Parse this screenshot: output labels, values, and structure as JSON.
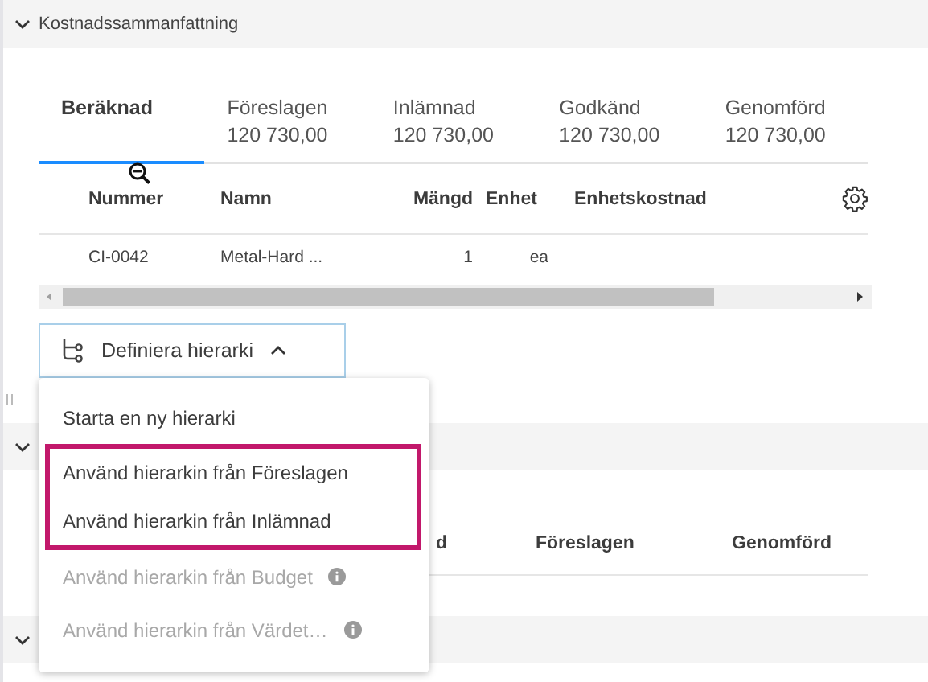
{
  "summary": {
    "title": "Kostnadssammanfattning",
    "expanded": true,
    "tabs": [
      {
        "label": "Beräknad",
        "selected": true
      },
      {
        "label": "Föreslagen",
        "value": "120 730,00",
        "selected": false
      },
      {
        "label": "Inlämnad",
        "value": "120 730,00",
        "selected": false
      },
      {
        "label": "Godkänd",
        "value": "120 730,00",
        "selected": false
      },
      {
        "label": "Genomförd",
        "value": "120 730,00",
        "selected": false
      }
    ],
    "table": {
      "columns": [
        "Nummer",
        "Namn",
        "Mängd",
        "Enhet",
        "Enhetskostnad"
      ],
      "rows": [
        [
          "CI-0042",
          "Metal-Hard ...",
          "1",
          "ea",
          ""
        ]
      ]
    },
    "hierarchy_button": {
      "label": "Definiera hierarki",
      "open": true
    }
  },
  "menu": {
    "items": [
      {
        "label": "Starta en ny hierarki",
        "disabled": false,
        "highlighted": false,
        "info": false
      },
      {
        "label": "Använd hierarkin från Föreslagen",
        "disabled": false,
        "highlighted": true,
        "info": false
      },
      {
        "label": "Använd hierarkin från Inlämnad",
        "disabled": false,
        "highlighted": true,
        "info": false
      },
      {
        "label": "Använd hierarkin från Budget",
        "disabled": true,
        "highlighted": false,
        "info": true
      },
      {
        "label": "Använd hierarkin från Värdet…",
        "disabled": true,
        "highlighted": false,
        "info": true
      }
    ]
  },
  "sections": [
    {
      "expanded": true,
      "columns": [
        "d",
        "Föreslagen",
        "Genomförd"
      ]
    },
    {
      "expanded": true
    }
  ]
}
